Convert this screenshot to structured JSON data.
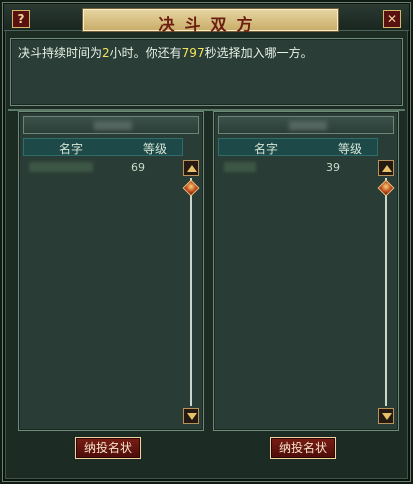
{
  "window": {
    "title": "决斗双方",
    "help_glyph": "?",
    "close_glyph": "✕"
  },
  "message": {
    "prefix": "决斗持续时间为",
    "hours": "2",
    "mid": "小时。你还有",
    "seconds": "797",
    "suffix": "秒选择加入哪一方。"
  },
  "left_panel": {
    "columns": {
      "name": "名字",
      "level": "等级"
    },
    "rows": [
      {
        "level": "69"
      }
    ],
    "button_label": "纳投名状"
  },
  "right_panel": {
    "columns": {
      "name": "名字",
      "level": "等级"
    },
    "rows": [
      {
        "level": "39"
      }
    ],
    "button_label": "纳投名状"
  },
  "icons": {
    "help": "help-icon",
    "close": "close-icon",
    "scroll_up": "arrow-up-icon",
    "scroll_down": "arrow-down-icon",
    "scroll_thumb": "diamond-thumb-icon"
  },
  "colors": {
    "highlight_number": "#f3e65a",
    "button_bg": "#7a1c16",
    "title_text": "#6a1c10"
  }
}
